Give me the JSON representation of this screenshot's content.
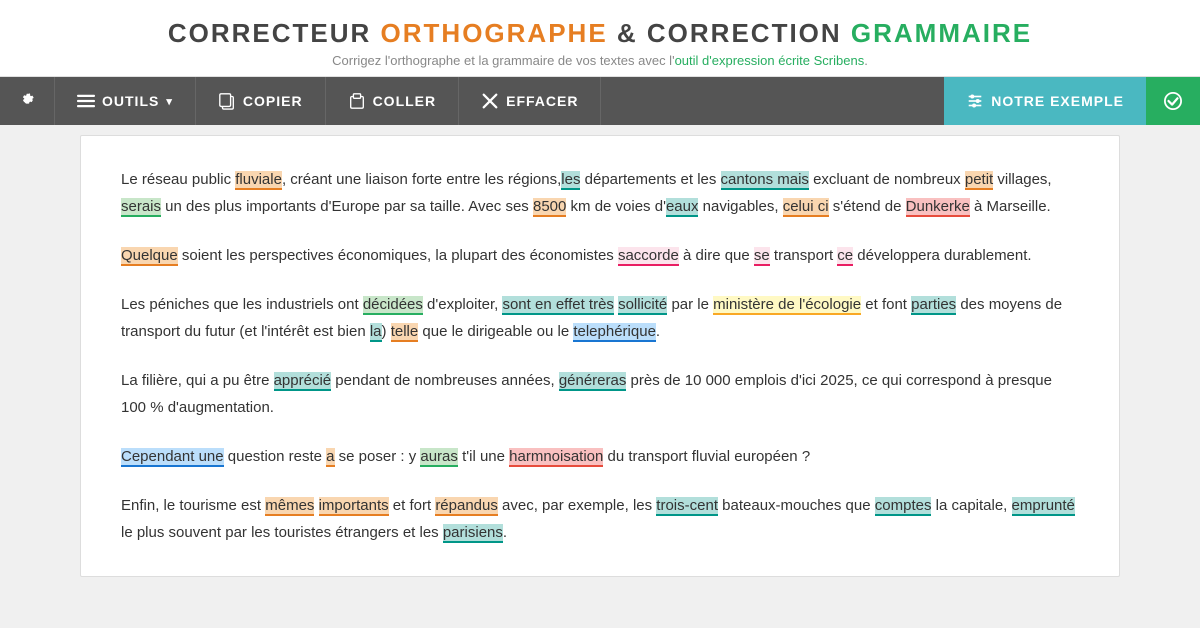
{
  "header": {
    "title_before": "CORRECTEUR ",
    "title_orange": "ORTHOGRAPHE",
    "title_mid": " & CORRECTION ",
    "title_green": "GRAMMAIRE",
    "subtitle": "Corrigez l'orthographe et la grammaire de vos textes avec l'outil d'expression écrite Scribens."
  },
  "toolbar": {
    "settings_label": "",
    "outils_label": "OUTILS",
    "copier_label": "COPIER",
    "coller_label": "COLLER",
    "effacer_label": "EFFACER",
    "notre_exemple_label": "NOTRE EXEMPLE",
    "check_icon": "✓"
  },
  "content": {
    "paragraphs": [
      "Le réseau public fluviale, créant une liaison forte entre les régions,les départements et les cantons mais excluant de nombreux petit villages, serais un des plus importants d'Europe par sa taille. Avec ses 8500 km de voies d'eaux navigables, celui ci s'étend de Dunkerke à Marseille.",
      "Quelque soient les perspectives économiques, la plupart des économistes saccorde à dire que se transport ce développera durablement.",
      "Les péniches que les industriels ont décidées d'exploiter, sont en effet très sollicité par le ministère de l'écologie et font parties des moyens de transport du futur (et l'intérêt est bien la) telle que le dirigeable ou le telephérique.",
      "La filière, qui a pu être apprécié pendant de nombreuses années, généreras près de 10 000 emplois d'ici 2025, ce qui correspond à presque 100 % d'augmentation.",
      "Cependant une question reste a se poser : y auras t'il une harmnoisation du transport fluvial européen ?",
      "Enfin, le tourisme est mêmes importants et fort répandus avec, par exemple, les trois-cent bateaux-mouches que comptes la capitale, emprunté le plus souvent par les touristes étrangers et les parisiens."
    ]
  }
}
